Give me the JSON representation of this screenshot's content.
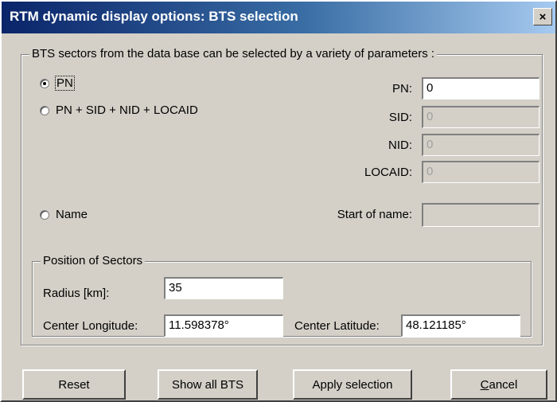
{
  "window": {
    "title": "RTM dynamic display options: BTS selection",
    "close_label": "×"
  },
  "selection_group": {
    "legend": "BTS sectors from the data base can be selected by a variety of parameters :",
    "options": [
      {
        "label": "PN",
        "checked": true
      },
      {
        "label": "PN + SID + NID + LOCAID",
        "checked": false
      },
      {
        "label": "Name",
        "checked": false
      }
    ],
    "fields": {
      "pn": {
        "label": "PN:",
        "value": "0"
      },
      "sid": {
        "label": "SID:",
        "value": "0"
      },
      "nid": {
        "label": "NID:",
        "value": "0"
      },
      "locaid": {
        "label": "LOCAID:",
        "value": "0"
      },
      "start_of_name": {
        "label": "Start of name:",
        "value": ""
      }
    }
  },
  "position_group": {
    "legend": "Position of Sectors",
    "radius": {
      "label": "Radius [km]:",
      "value": "35"
    },
    "center_longitude": {
      "label": "Center Longitude:",
      "value": "11.598378°"
    },
    "center_latitude": {
      "label": "Center Latitude:",
      "value": "48.121185°"
    }
  },
  "buttons": {
    "reset": "Reset",
    "show_all": "Show all BTS",
    "apply": "Apply selection",
    "cancel": "Cancel"
  }
}
